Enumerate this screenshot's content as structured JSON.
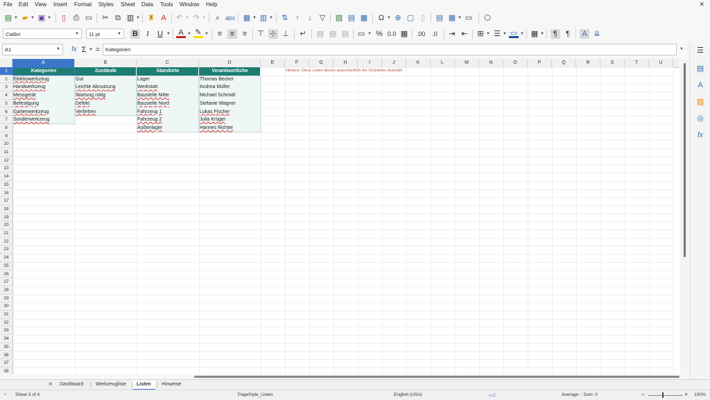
{
  "menubar": {
    "items": [
      "File",
      "Edit",
      "View",
      "Insert",
      "Format",
      "Styles",
      "Sheet",
      "Data",
      "Tools",
      "Window",
      "Help"
    ],
    "close_glyph": "✕"
  },
  "toolbar2": {
    "font_name": "Calibri",
    "font_size": "11 pt"
  },
  "formula_bar": {
    "cell_ref": "A1",
    "content": "Kategorien"
  },
  "columns": [
    "A",
    "B",
    "C",
    "D",
    "E",
    "F",
    "G",
    "H",
    "I",
    "J",
    "K",
    "L",
    "M",
    "N",
    "O",
    "P",
    "Q",
    "R",
    "S",
    "T",
    "U"
  ],
  "rows": [
    "1",
    "2",
    "3",
    "4",
    "5",
    "6",
    "7",
    "8",
    "9",
    "10",
    "11",
    "12",
    "13",
    "14",
    "15",
    "16",
    "17",
    "18",
    "19",
    "20",
    "21",
    "22",
    "23",
    "24",
    "25",
    "26",
    "27",
    "28",
    "29",
    "30",
    "31",
    "32",
    "33",
    "34",
    "35",
    "36",
    "37",
    "38"
  ],
  "table": {
    "headers": [
      "Kategorien",
      "Zustände",
      "Standorte",
      "Verantwortliche"
    ],
    "kategorien": [
      "Elektrowerkzeug",
      "Handwerkzeug",
      "Messgerät",
      "Befestigung",
      "Gartenwerkzeug",
      "Sonderwerkzeug"
    ],
    "zustaende": [
      "Gut",
      "Leichte Abnutzung",
      "Wartung nötig",
      "Defekt",
      "Verliehen"
    ],
    "standorte": [
      "Lager",
      "Werkstatt",
      "Baustelle Mitte",
      "Baustelle Nord",
      "Fahrzeug 1",
      "Fahrzeug 2",
      "Außenlager"
    ],
    "verantwortliche": [
      "Thomas Becker",
      "Andrea Müller",
      "Michael Schmidt",
      "Stefanie Wagner",
      "Lukas Fischer",
      "Julia Krüger",
      "Hannes Richter"
    ]
  },
  "note": "Hinweis: Diese Listen dienen ausschließlich der Dropdown-Auswahl",
  "sheet_tabs": [
    "Dashboard",
    "Werkzeugliste",
    "Listen",
    "Hinweise"
  ],
  "active_tab": "Listen",
  "statusbar": {
    "sheet_info": "Sheet 3 of 4",
    "page_style": "PageStyle_Listen",
    "language": "English (USA)",
    "sum_info": "Average: ; Sum: 0",
    "zoom": "100%"
  },
  "colors": {
    "header_fill": "#1d7d72",
    "selection": "#3b78c9",
    "note_text": "#c94b4b"
  }
}
